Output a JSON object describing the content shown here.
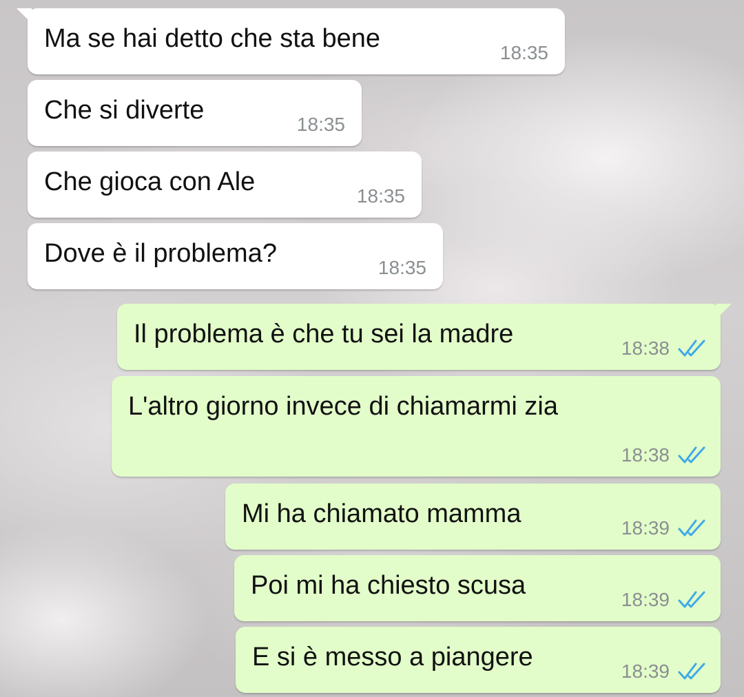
{
  "chat": {
    "messages": [
      {
        "text": "Ma se hai detto che sta bene",
        "time": "18:35",
        "direction": "incoming"
      },
      {
        "text": "Che si diverte",
        "time": "18:35",
        "direction": "incoming"
      },
      {
        "text": "Che gioca con Ale",
        "time": "18:35",
        "direction": "incoming"
      },
      {
        "text": "Dove è il problema?",
        "time": "18:35",
        "direction": "incoming"
      },
      {
        "text": "Il problema è che tu sei la madre",
        "time": "18:38",
        "direction": "outgoing",
        "status": "read"
      },
      {
        "text": "L'altro giorno invece di chiamarmi zia",
        "time": "18:38",
        "direction": "outgoing",
        "status": "read"
      },
      {
        "text": "Mi ha chiamato mamma",
        "time": "18:39",
        "direction": "outgoing",
        "status": "read"
      },
      {
        "text": "Poi mi ha chiesto scusa",
        "time": "18:39",
        "direction": "outgoing",
        "status": "read"
      },
      {
        "text": "E si è messo a piangere",
        "time": "18:39",
        "direction": "outgoing",
        "status": "read"
      }
    ]
  },
  "colors": {
    "incoming_bubble": "#ffffff",
    "outgoing_bubble": "#e2fdc9",
    "read_tick": "#3fa9e8",
    "timestamp": "#8a8f92"
  },
  "icons": {
    "read_status": "double-check-icon"
  }
}
